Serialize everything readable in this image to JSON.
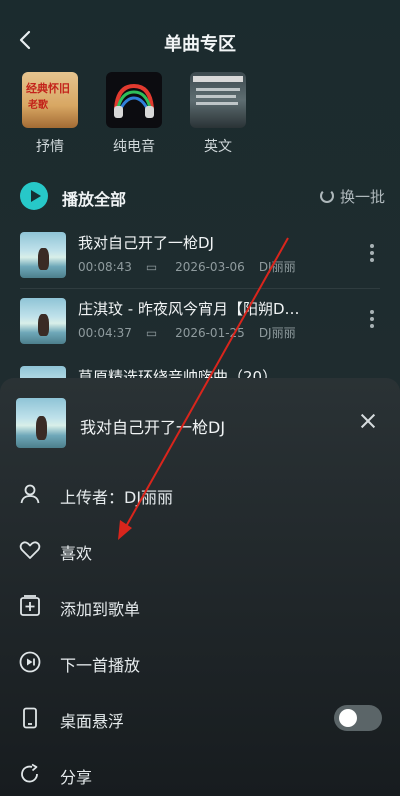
{
  "header": {
    "title": "单曲专区"
  },
  "categories": [
    {
      "label": "抒情"
    },
    {
      "label": "纯电音"
    },
    {
      "label": "英文"
    }
  ],
  "playall": {
    "label": "播放全部",
    "refresh_label": "换一批"
  },
  "songs": [
    {
      "name": "我对自己开了一枪DJ",
      "duration": "00:08:43",
      "date": "2026-03-06",
      "uploader": "DJ丽丽"
    },
    {
      "name": "庄淇玟 - 昨夜风今宵月【阳朔D…",
      "duration": "00:04:37",
      "date": "2026-01-25",
      "uploader": "DJ丽丽"
    },
    {
      "name": "草原精选环绕音帅嗨曲（20）"
    }
  ],
  "sheet": {
    "song_name": "我对自己开了一枪DJ",
    "options": [
      {
        "label": "上传者：DJ丽丽",
        "icon": "person-icon"
      },
      {
        "label": "喜欢",
        "icon": "heart-icon"
      },
      {
        "label": "添加到歌单",
        "icon": "add-playlist-icon"
      },
      {
        "label": "下一首播放",
        "icon": "next-play-icon"
      },
      {
        "label": "桌面悬浮",
        "icon": "phone-icon",
        "toggle": false
      },
      {
        "label": "分享",
        "icon": "share-icon"
      }
    ]
  },
  "colors": {
    "accent": "#27c8c8",
    "annotation": "#d9251c"
  }
}
